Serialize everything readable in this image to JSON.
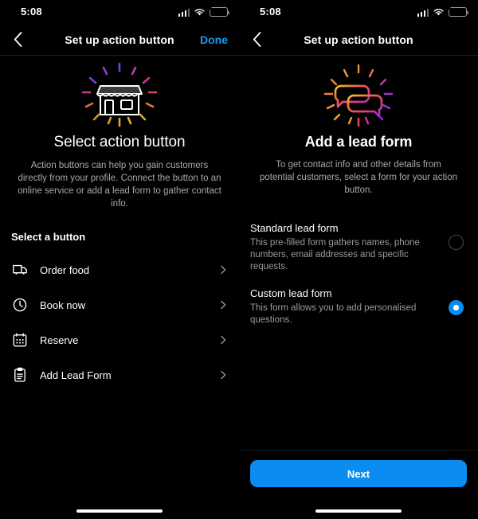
{
  "left": {
    "status": {
      "time": "5:08",
      "cellular_icon": "cellular-signal-icon",
      "wifi_icon": "wifi-icon",
      "battery_icon": "battery-charging-icon"
    },
    "nav": {
      "back_icon": "chevron-left-icon",
      "title": "Set up action button",
      "action": "Done"
    },
    "hero_icon": "storefront-icon",
    "headline": "Select action button",
    "subtext": "Action buttons can help you gain customers directly from your profile. Connect the button to an online service or add a lead form to gather contact info.",
    "section_label": "Select a button",
    "items": [
      {
        "label": "Order food",
        "icon": "delivery-truck-icon",
        "chevron": "chevron-right-icon"
      },
      {
        "label": "Book now",
        "icon": "clock-icon",
        "chevron": "chevron-right-icon"
      },
      {
        "label": "Reserve",
        "icon": "calendar-icon",
        "chevron": "chevron-right-icon"
      },
      {
        "label": "Add Lead Form",
        "icon": "clipboard-icon",
        "chevron": "chevron-right-icon"
      }
    ],
    "home_indicator": "home-indicator"
  },
  "right": {
    "status": {
      "time": "5:08",
      "cellular_icon": "cellular-signal-icon",
      "wifi_icon": "wifi-icon",
      "battery_icon": "battery-charging-icon"
    },
    "nav": {
      "back_icon": "chevron-left-icon",
      "title": "Set up action button",
      "action": ""
    },
    "hero_icon": "speech-bubbles-icon",
    "headline": "Add a lead form",
    "subtext": "To get contact info and other details from potential customers, select a form for your action button.",
    "options": [
      {
        "title": "Standard lead form",
        "desc": "This pre-filled form gathers names, phone numbers, email addresses and specific requests.",
        "selected": false
      },
      {
        "title": "Custom lead form",
        "desc": "This form allows you to add personalised questions.",
        "selected": true
      }
    ],
    "next_label": "Next",
    "home_indicator": "home-indicator"
  },
  "colors": {
    "accent_blue": "#0a8cf0",
    "link_blue": "#1a9bf0",
    "battery_green": "#32d74b",
    "background": "#000000",
    "secondary_text": "#a8a8a8"
  }
}
